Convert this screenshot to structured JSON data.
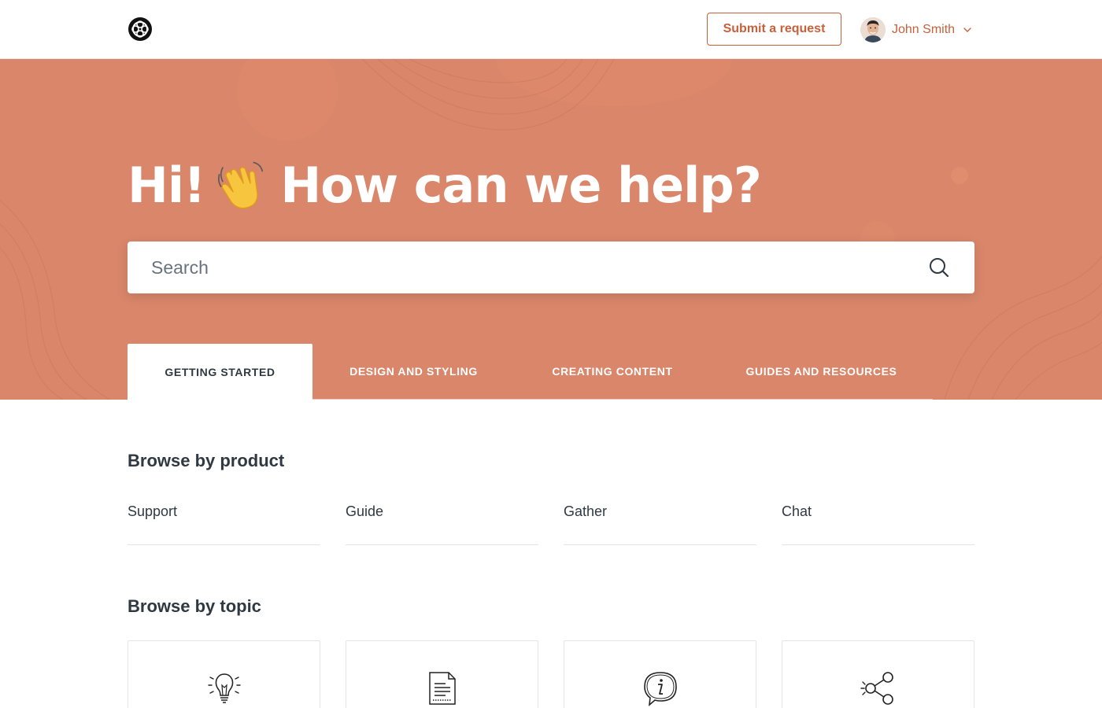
{
  "header": {
    "submit_label": "Submit a request",
    "user_name": "John Smith"
  },
  "hero": {
    "title_before": "Hi!",
    "title_after": "How can we help?",
    "search_placeholder": "Search"
  },
  "tabs": [
    {
      "label": "GETTING STARTED",
      "active": true
    },
    {
      "label": "DESIGN AND STYLING",
      "active": false
    },
    {
      "label": "CREATING CONTENT",
      "active": false
    },
    {
      "label": "GUIDES AND RESOURCES",
      "active": false
    }
  ],
  "products": {
    "title": "Browse by product",
    "items": [
      "Support",
      "Guide",
      "Gather",
      "Chat"
    ]
  },
  "topics": {
    "title": "Browse by topic",
    "icons": [
      "lightbulb-icon",
      "document-icon",
      "info-speech-bubble-icon",
      "share-icon"
    ]
  },
  "colors": {
    "brand": "#c8603c",
    "hero_bg": "#d9866a",
    "text": "#2f3941"
  }
}
